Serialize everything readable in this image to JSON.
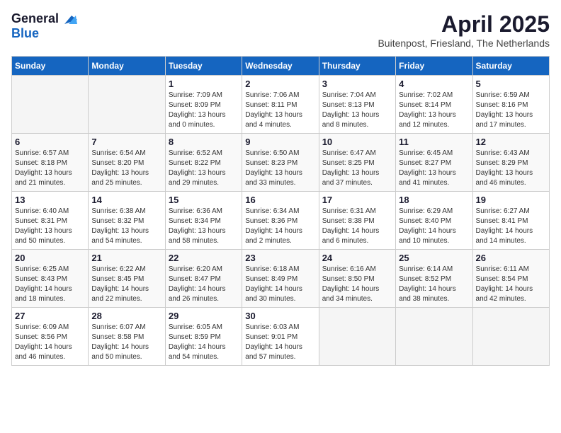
{
  "header": {
    "logo_general": "General",
    "logo_blue": "Blue",
    "title": "April 2025",
    "subtitle": "Buitenpost, Friesland, The Netherlands"
  },
  "days_of_week": [
    "Sunday",
    "Monday",
    "Tuesday",
    "Wednesday",
    "Thursday",
    "Friday",
    "Saturday"
  ],
  "weeks": [
    [
      {
        "day": "",
        "info": ""
      },
      {
        "day": "",
        "info": ""
      },
      {
        "day": "1",
        "info": "Sunrise: 7:09 AM\nSunset: 8:09 PM\nDaylight: 13 hours and 0 minutes."
      },
      {
        "day": "2",
        "info": "Sunrise: 7:06 AM\nSunset: 8:11 PM\nDaylight: 13 hours and 4 minutes."
      },
      {
        "day": "3",
        "info": "Sunrise: 7:04 AM\nSunset: 8:13 PM\nDaylight: 13 hours and 8 minutes."
      },
      {
        "day": "4",
        "info": "Sunrise: 7:02 AM\nSunset: 8:14 PM\nDaylight: 13 hours and 12 minutes."
      },
      {
        "day": "5",
        "info": "Sunrise: 6:59 AM\nSunset: 8:16 PM\nDaylight: 13 hours and 17 minutes."
      }
    ],
    [
      {
        "day": "6",
        "info": "Sunrise: 6:57 AM\nSunset: 8:18 PM\nDaylight: 13 hours and 21 minutes."
      },
      {
        "day": "7",
        "info": "Sunrise: 6:54 AM\nSunset: 8:20 PM\nDaylight: 13 hours and 25 minutes."
      },
      {
        "day": "8",
        "info": "Sunrise: 6:52 AM\nSunset: 8:22 PM\nDaylight: 13 hours and 29 minutes."
      },
      {
        "day": "9",
        "info": "Sunrise: 6:50 AM\nSunset: 8:23 PM\nDaylight: 13 hours and 33 minutes."
      },
      {
        "day": "10",
        "info": "Sunrise: 6:47 AM\nSunset: 8:25 PM\nDaylight: 13 hours and 37 minutes."
      },
      {
        "day": "11",
        "info": "Sunrise: 6:45 AM\nSunset: 8:27 PM\nDaylight: 13 hours and 41 minutes."
      },
      {
        "day": "12",
        "info": "Sunrise: 6:43 AM\nSunset: 8:29 PM\nDaylight: 13 hours and 46 minutes."
      }
    ],
    [
      {
        "day": "13",
        "info": "Sunrise: 6:40 AM\nSunset: 8:31 PM\nDaylight: 13 hours and 50 minutes."
      },
      {
        "day": "14",
        "info": "Sunrise: 6:38 AM\nSunset: 8:32 PM\nDaylight: 13 hours and 54 minutes."
      },
      {
        "day": "15",
        "info": "Sunrise: 6:36 AM\nSunset: 8:34 PM\nDaylight: 13 hours and 58 minutes."
      },
      {
        "day": "16",
        "info": "Sunrise: 6:34 AM\nSunset: 8:36 PM\nDaylight: 14 hours and 2 minutes."
      },
      {
        "day": "17",
        "info": "Sunrise: 6:31 AM\nSunset: 8:38 PM\nDaylight: 14 hours and 6 minutes."
      },
      {
        "day": "18",
        "info": "Sunrise: 6:29 AM\nSunset: 8:40 PM\nDaylight: 14 hours and 10 minutes."
      },
      {
        "day": "19",
        "info": "Sunrise: 6:27 AM\nSunset: 8:41 PM\nDaylight: 14 hours and 14 minutes."
      }
    ],
    [
      {
        "day": "20",
        "info": "Sunrise: 6:25 AM\nSunset: 8:43 PM\nDaylight: 14 hours and 18 minutes."
      },
      {
        "day": "21",
        "info": "Sunrise: 6:22 AM\nSunset: 8:45 PM\nDaylight: 14 hours and 22 minutes."
      },
      {
        "day": "22",
        "info": "Sunrise: 6:20 AM\nSunset: 8:47 PM\nDaylight: 14 hours and 26 minutes."
      },
      {
        "day": "23",
        "info": "Sunrise: 6:18 AM\nSunset: 8:49 PM\nDaylight: 14 hours and 30 minutes."
      },
      {
        "day": "24",
        "info": "Sunrise: 6:16 AM\nSunset: 8:50 PM\nDaylight: 14 hours and 34 minutes."
      },
      {
        "day": "25",
        "info": "Sunrise: 6:14 AM\nSunset: 8:52 PM\nDaylight: 14 hours and 38 minutes."
      },
      {
        "day": "26",
        "info": "Sunrise: 6:11 AM\nSunset: 8:54 PM\nDaylight: 14 hours and 42 minutes."
      }
    ],
    [
      {
        "day": "27",
        "info": "Sunrise: 6:09 AM\nSunset: 8:56 PM\nDaylight: 14 hours and 46 minutes."
      },
      {
        "day": "28",
        "info": "Sunrise: 6:07 AM\nSunset: 8:58 PM\nDaylight: 14 hours and 50 minutes."
      },
      {
        "day": "29",
        "info": "Sunrise: 6:05 AM\nSunset: 8:59 PM\nDaylight: 14 hours and 54 minutes."
      },
      {
        "day": "30",
        "info": "Sunrise: 6:03 AM\nSunset: 9:01 PM\nDaylight: 14 hours and 57 minutes."
      },
      {
        "day": "",
        "info": ""
      },
      {
        "day": "",
        "info": ""
      },
      {
        "day": "",
        "info": ""
      }
    ]
  ]
}
